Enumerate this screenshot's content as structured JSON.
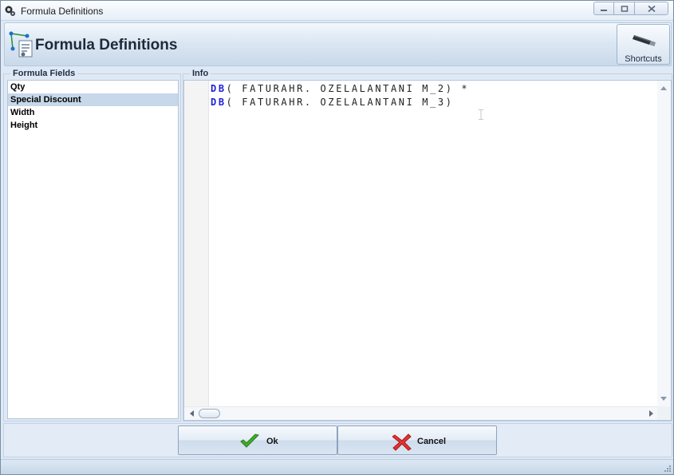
{
  "window": {
    "title": "Formula Definitions",
    "controls": [
      "minimize-icon",
      "maximize-icon",
      "close-icon"
    ]
  },
  "header": {
    "title": "Formula Definitions",
    "shortcuts_label": "Shortcuts"
  },
  "fields": {
    "label": "Formula Fields",
    "items": [
      "Qty",
      "Special Discount",
      "Width",
      "Height"
    ],
    "selected": "Special Discount"
  },
  "info": {
    "label": "Info",
    "lines": [
      {
        "keyword": "DB",
        "rest": "( FATURAHR. OZELALANTANI M_2) *"
      },
      {
        "keyword": "DB",
        "rest": "( FATURAHR. OZELALANTANI M_3)"
      }
    ]
  },
  "buttons": {
    "ok_label": "Ok",
    "cancel_label": "Cancel"
  },
  "colors": {
    "keyword": "#1f1fd6",
    "selection": "#c6d8ea",
    "window_bg": "#dfe9f5"
  }
}
